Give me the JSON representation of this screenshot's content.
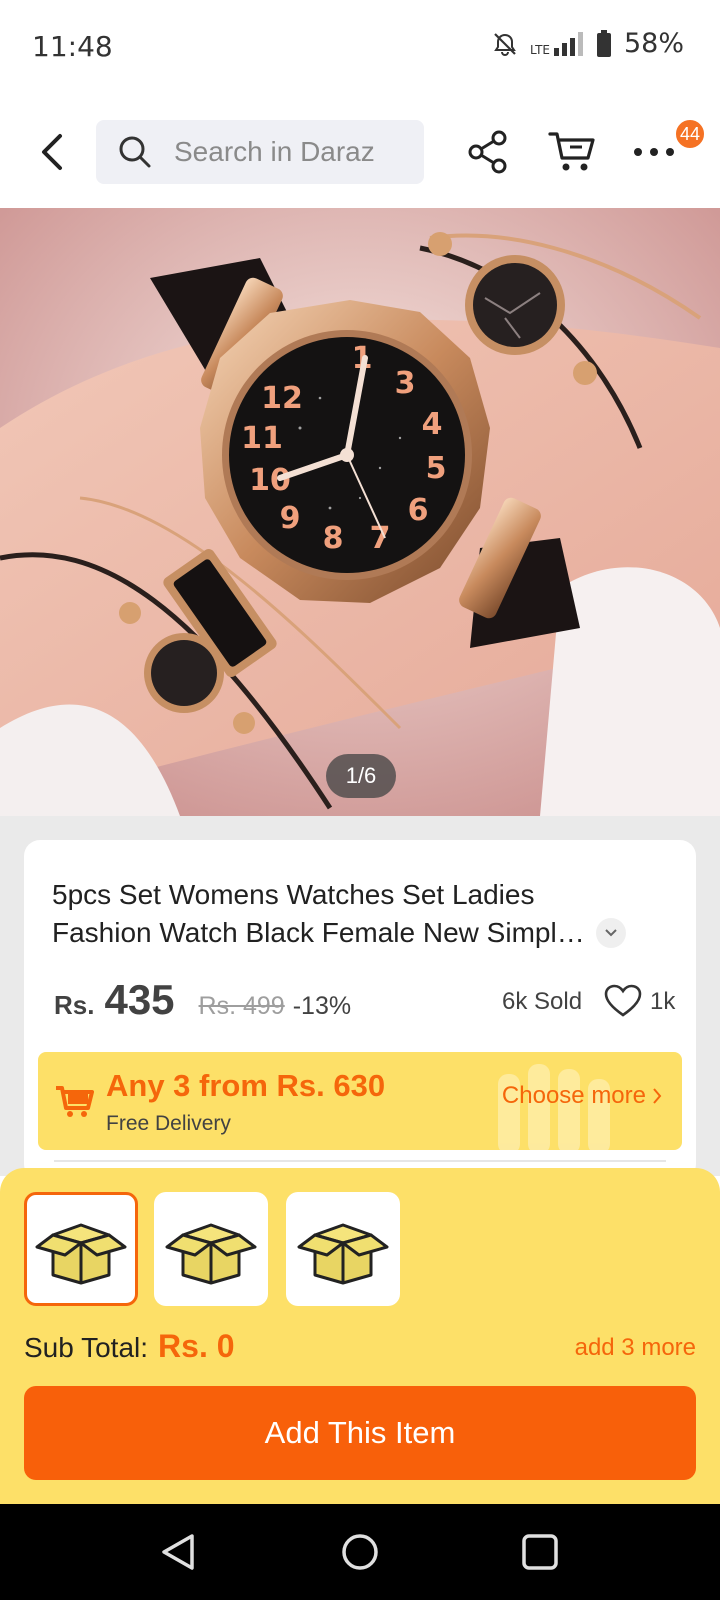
{
  "status_bar": {
    "time": "11:48",
    "network": "LTE",
    "battery": "58%",
    "icons": [
      "mute-icon",
      "signal-icon",
      "battery-icon"
    ]
  },
  "top_nav": {
    "search_placeholder": "Search in Daraz",
    "cart_badge": "44",
    "icons": [
      "back-icon",
      "search-icon",
      "share-icon",
      "cart-icon",
      "more-icon"
    ]
  },
  "gallery": {
    "counter": "1/6",
    "current": 1,
    "total": 6
  },
  "product": {
    "title_line1": "5pcs Set Womens Watches Set Ladies",
    "title_line2": "Fashion Watch Black Female New Simple Quartz",
    "currency": "Rs.",
    "price": "435",
    "original_price": "Rs. 499",
    "discount": "-13%",
    "sold": "6k Sold",
    "likes": "1k"
  },
  "promo": {
    "title": "Any 3 from Rs. 630",
    "subtitle": "Free Delivery",
    "cta": "Choose more"
  },
  "bundle": {
    "slots": [
      {
        "icon": "box-icon",
        "selected": true
      },
      {
        "icon": "box-icon",
        "selected": false
      },
      {
        "icon": "box-icon",
        "selected": false
      }
    ],
    "subtotal_label": "Sub Total:",
    "subtotal_value": "Rs. 0",
    "add_more": "add 3 more",
    "button_label": "Add This Item"
  },
  "colors": {
    "accent": "#f5660b",
    "promo_bg": "#fde068",
    "button": "#f8600a"
  }
}
